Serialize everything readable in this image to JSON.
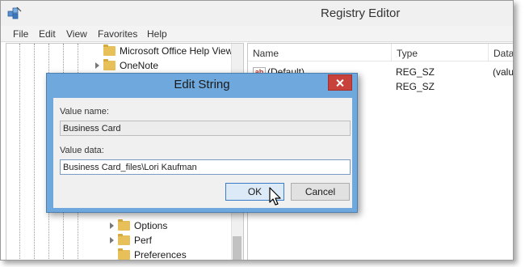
{
  "window": {
    "title": "Registry Editor"
  },
  "menu": [
    "File",
    "Edit",
    "View",
    "Favorites",
    "Help"
  ],
  "tree": {
    "items": [
      {
        "label": "Microsoft Office Help View",
        "expandable": false
      },
      {
        "label": "OneNote",
        "expandable": true
      },
      {
        "label": "Options",
        "expandable": true
      },
      {
        "label": "Perf",
        "expandable": true
      },
      {
        "label": "Preferences",
        "expandable": false
      }
    ]
  },
  "list": {
    "columns": [
      "Name",
      "Type",
      "Data"
    ],
    "rows": [
      {
        "name": "(Default)",
        "type": "REG_SZ",
        "data": "(valu",
        "icon": "string-value-icon"
      },
      {
        "name": "",
        "type": "REG_SZ",
        "data": "",
        "icon": ""
      }
    ]
  },
  "dialog": {
    "title": "Edit String",
    "value_name_label": "Value name:",
    "value_name": "Business Card",
    "value_data_label": "Value data:",
    "value_data": "Business Card_files\\Lori Kaufman",
    "ok_label": "OK",
    "cancel_label": "Cancel"
  },
  "colors": {
    "dialog_frame": "#6fa8dc",
    "close_button": "#c8413a",
    "folder": "#e8c05a"
  }
}
